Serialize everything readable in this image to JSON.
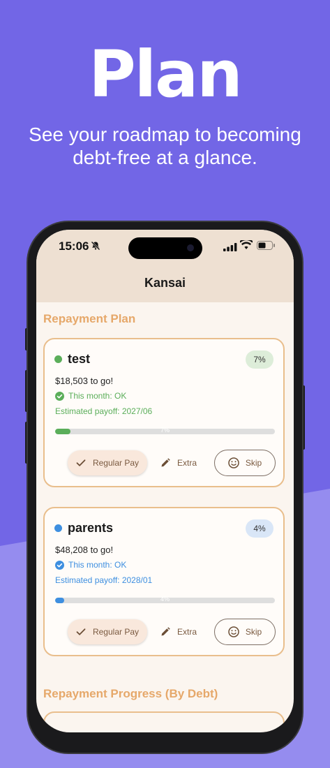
{
  "marketing": {
    "headline": "Plan",
    "subline_1": "See your roadmap to becoming",
    "subline_2": "debt-free at a glance."
  },
  "status_bar": {
    "time": "15:06"
  },
  "app": {
    "title": "Kansai"
  },
  "sections": {
    "plan_title": "Repayment Plan",
    "progress_title": "Repayment Progress (By Debt)"
  },
  "debts": [
    {
      "name": "test",
      "percent_label": "7%",
      "percent": 7,
      "remaining": "$18,503 to go!",
      "status": "This month: OK",
      "payoff": "Estimated payoff: 2027/06",
      "color": "#5BAE5A",
      "badge_bg": "#DDEDD9"
    },
    {
      "name": "parents",
      "percent_label": "4%",
      "percent": 4,
      "remaining": "$48,208 to go!",
      "status": "This month: OK",
      "payoff": "Estimated payoff: 2028/01",
      "color": "#3E8FE0",
      "badge_bg": "#D9E6F7"
    }
  ],
  "actions": {
    "regular_pay": "Regular Pay",
    "extra": "Extra",
    "skip": "Skip"
  },
  "icons": [
    "bell-slash-icon",
    "signal-icon",
    "wifi-icon",
    "battery-icon",
    "check-circle-icon",
    "check-icon",
    "pencil-icon",
    "smiley-icon"
  ]
}
